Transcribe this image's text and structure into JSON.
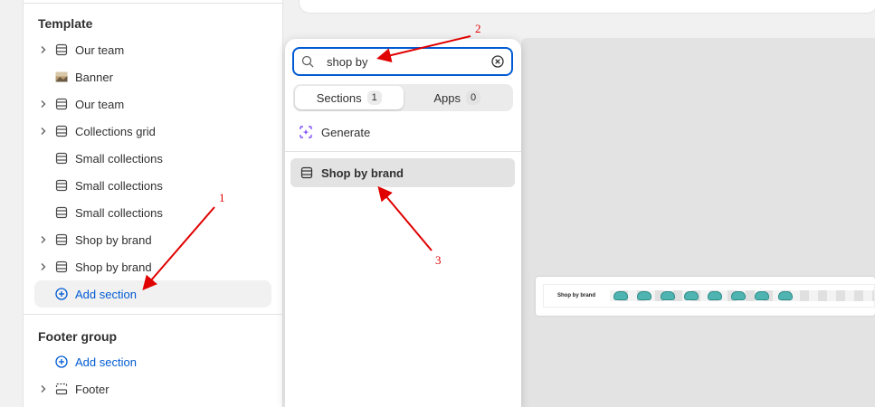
{
  "sidebar": {
    "template_title": "Template",
    "items": [
      {
        "label": "Our team",
        "icon": "section-icon",
        "expandable": true
      },
      {
        "label": "Banner",
        "icon": "image-thumbnail-icon",
        "expandable": false
      },
      {
        "label": "Our team",
        "icon": "section-icon",
        "expandable": true
      },
      {
        "label": "Collections grid",
        "icon": "section-icon",
        "expandable": true
      },
      {
        "label": "Small collections",
        "icon": "section-icon",
        "expandable": false
      },
      {
        "label": "Small collections",
        "icon": "section-icon",
        "expandable": false
      },
      {
        "label": "Small collections",
        "icon": "section-icon",
        "expandable": false
      },
      {
        "label": "Shop by brand",
        "icon": "section-icon",
        "expandable": true
      },
      {
        "label": "Shop by brand",
        "icon": "section-icon",
        "expandable": true
      }
    ],
    "add_section_label": "Add section",
    "footer_group_title": "Footer group",
    "footer_add_section_label": "Add section",
    "footer_item": {
      "label": "Footer",
      "icon": "footer-section-icon",
      "expandable": true
    }
  },
  "picker": {
    "search_value": "shop by",
    "tabs": [
      {
        "label": "Sections",
        "count": "1",
        "active": true
      },
      {
        "label": "Apps",
        "count": "0",
        "active": false
      }
    ],
    "generate_label": "Generate",
    "results": [
      {
        "label": "Shop by brand",
        "icon": "section-icon"
      }
    ]
  },
  "preview": {
    "title": "Shop by brand"
  },
  "annotations": [
    {
      "number": "1"
    },
    {
      "number": "2"
    },
    {
      "number": "3"
    }
  ],
  "colors": {
    "accent": "#005bd3",
    "annotation_red": "#e00000",
    "generate_purple": "#8051ff",
    "preview_logo": "#4fb4b1"
  }
}
